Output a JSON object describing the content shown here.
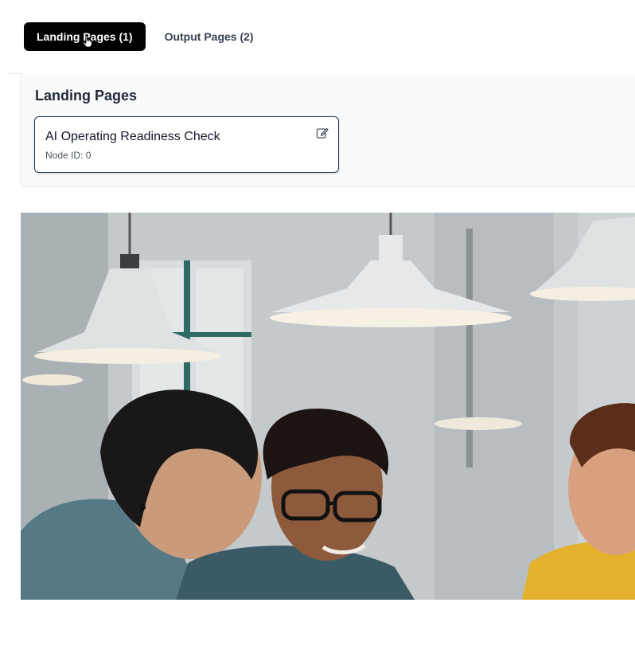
{
  "tabs": [
    {
      "label": "Landing Pages (1)",
      "active": true
    },
    {
      "label": "Output Pages (2)",
      "active": false
    }
  ],
  "panel": {
    "title": "Landing Pages",
    "cards": [
      {
        "title": "AI Operating Readiness Check",
        "node_id": "Node ID: 0"
      }
    ]
  },
  "hero": {
    "subject": "three people looking at a laptop under pendant lamps in an office"
  },
  "colors": {
    "active_tab_bg": "#000000",
    "card_border": "#1e3a5f",
    "panel_bg": "#f9fafb"
  }
}
